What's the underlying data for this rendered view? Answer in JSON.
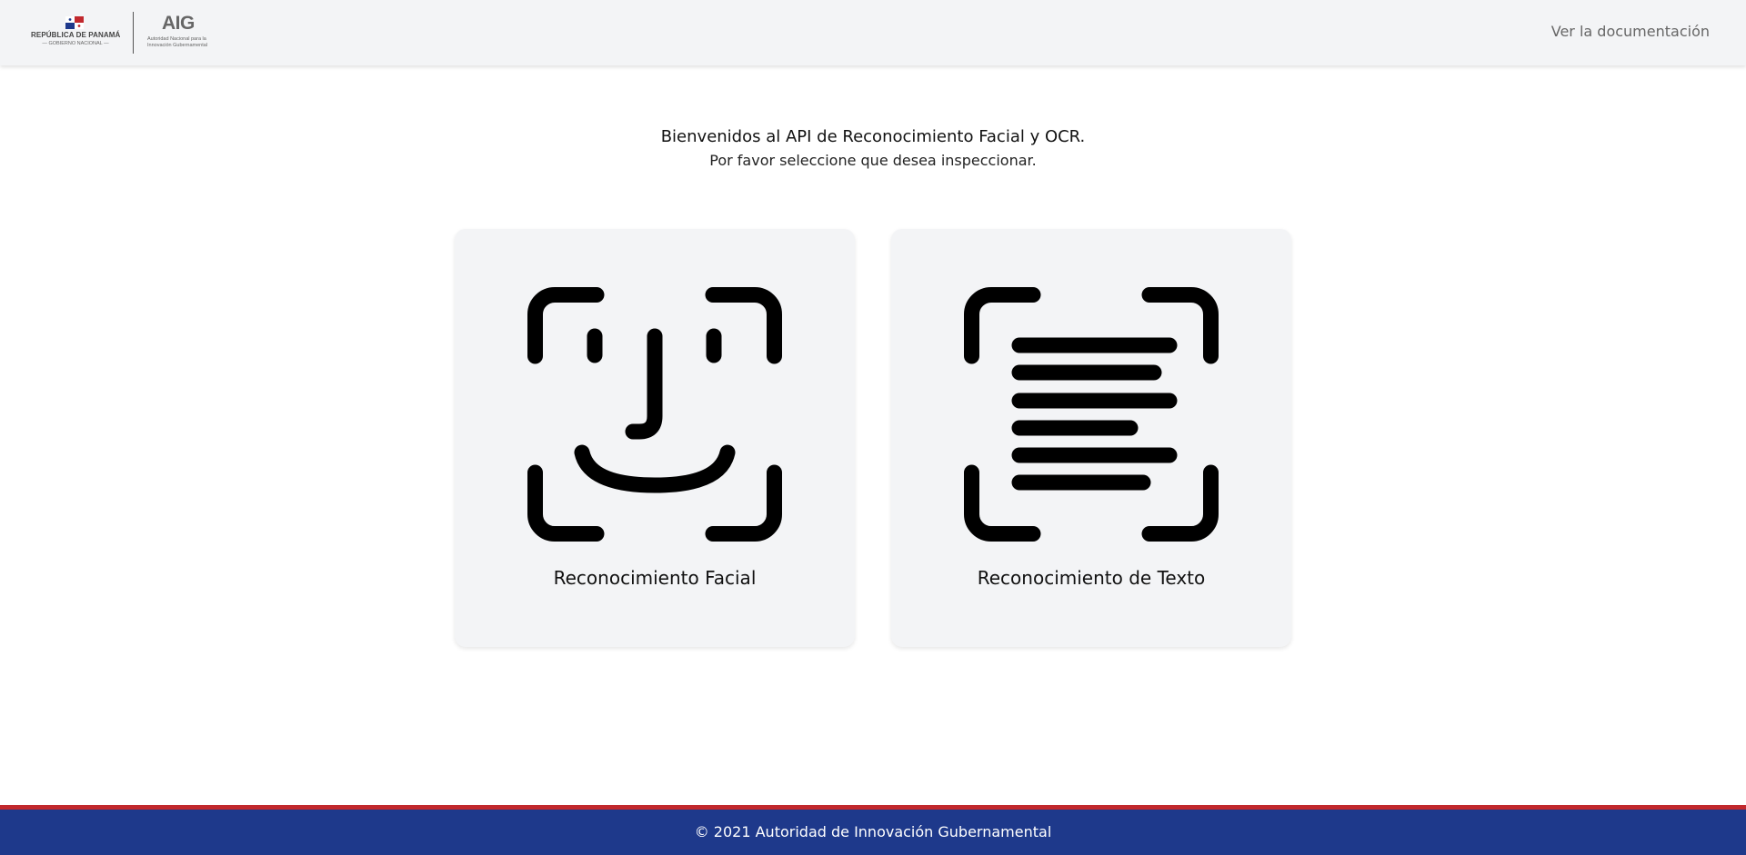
{
  "header": {
    "gov_logo": {
      "name": "REPÚBLICA DE PANAMÁ",
      "sub": "GOBIERNO NACIONAL"
    },
    "aig_logo": {
      "title": "AIG",
      "sub_line1": "Autoridad Nacional para la",
      "sub_line2": "Innovación Gubernamental"
    },
    "doc_link": "Ver la documentación"
  },
  "main": {
    "title": "Bienvenidos al API de Reconocimiento Facial y OCR.",
    "subtitle": "Por favor seleccione que desea inspeccionar.",
    "cards": [
      {
        "label": "Reconocimiento Facial",
        "icon": "face-scan-icon"
      },
      {
        "label": "Reconocimiento de Texto",
        "icon": "text-scan-icon"
      }
    ]
  },
  "footer": {
    "text": "© 2021 Autoridad de Innovación Gubernamental"
  },
  "colors": {
    "header_bg": "#f3f4f6",
    "card_bg": "#f3f4f6",
    "footer_bg": "#1e398b",
    "footer_stripe": "#c1282d",
    "icon": "#000000"
  }
}
